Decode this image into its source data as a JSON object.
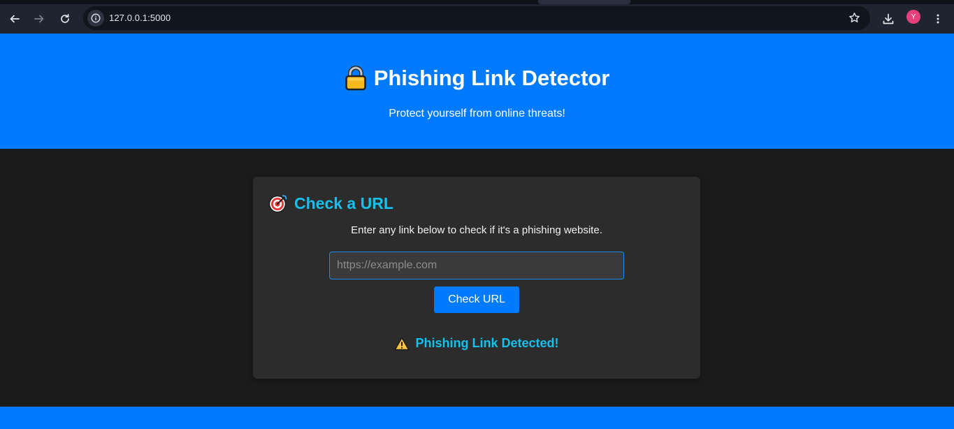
{
  "browser": {
    "url": "127.0.0.1:5000",
    "profile_initial": "Y"
  },
  "header": {
    "title": "Phishing Link Detector",
    "subtitle": "Protect yourself from online threats!"
  },
  "card": {
    "title": "Check a URL",
    "description": "Enter any link below to check if it's a phishing website.",
    "input_placeholder": "https://example.com",
    "input_value": "",
    "button_label": "Check URL",
    "result_text": "Phishing Link Detected!"
  },
  "icons": {
    "header": "lock-icon",
    "card": "target-icon",
    "result": "warning-icon"
  },
  "colors": {
    "primary": "#007bff",
    "accent_text": "#17c0ea",
    "page_bg": "#1b1b1b",
    "card_bg": "#2c2c2c"
  }
}
